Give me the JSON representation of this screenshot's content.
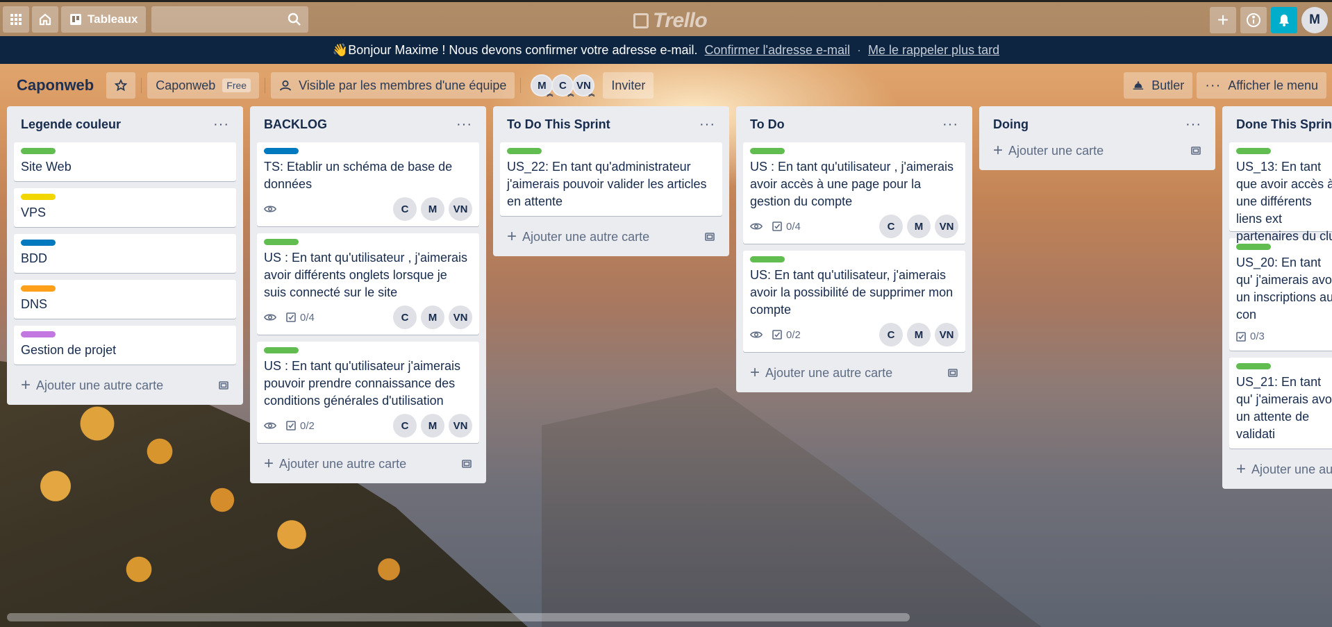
{
  "header": {
    "boards_label": "Tableaux",
    "logo_text": "Trello",
    "avatar_initial": "M"
  },
  "banner": {
    "message": "👋Bonjour Maxime ! Nous devons confirmer votre adresse e-mail.",
    "confirm_link": "Confirmer l'adresse e-mail",
    "separator": "·",
    "remind_link": "Me le rappeler plus tard"
  },
  "board": {
    "title": "Caponweb",
    "team_name": "Caponweb",
    "plan_badge": "Free",
    "visibility": "Visible par les membres d'une équipe",
    "members": [
      "M",
      "C",
      "VN"
    ],
    "invite_label": "Inviter",
    "butler_label": "Butler",
    "menu_label": "Afficher le menu"
  },
  "lists": [
    {
      "title": "Legende couleur",
      "add_label": "Ajouter une autre carte",
      "cards": [
        {
          "label_color": "#61bd4f",
          "text": "Site Web"
        },
        {
          "label_color": "#f2d600",
          "text": "VPS"
        },
        {
          "label_color": "#0079bf",
          "text": "BDD"
        },
        {
          "label_color": "#ff9f1a",
          "text": "DNS"
        },
        {
          "label_color": "#c377e0",
          "text": "Gestion de projet"
        }
      ]
    },
    {
      "title": "BACKLOG",
      "add_label": "Ajouter une autre carte",
      "cards": [
        {
          "label_color": "#0079bf",
          "text": "TS: Etablir un schéma de base de données",
          "checklist": "",
          "members": [
            "C",
            "M",
            "VN"
          ]
        },
        {
          "label_color": "#61bd4f",
          "text": "US : En tant qu'utilisateur , j'aimerais avoir différents onglets lorsque je suis connecté sur le site",
          "checklist": "0/4",
          "members": [
            "C",
            "M",
            "VN"
          ]
        },
        {
          "label_color": "#61bd4f",
          "text": "US : En tant qu'utilisateur j'aimerais pouvoir prendre connaissance des conditions générales d'utilisation",
          "checklist": "0/2",
          "members": [
            "C",
            "M",
            "VN"
          ]
        }
      ]
    },
    {
      "title": "To Do This Sprint",
      "add_label": "Ajouter une autre carte",
      "cards": [
        {
          "label_color": "#61bd4f",
          "text": "US_22: En tant qu'administrateur j'aimerais pouvoir valider les articles en attente"
        }
      ]
    },
    {
      "title": "To Do",
      "add_label": "Ajouter une autre carte",
      "cards": [
        {
          "label_color": "#61bd4f",
          "text": "US : En tant qu'utilisateur , j'aimerais avoir accès à une page pour la gestion du compte",
          "checklist": "0/4",
          "members": [
            "C",
            "M",
            "VN"
          ]
        },
        {
          "label_color": "#61bd4f",
          "text": "US: En tant qu'utilisateur, j'aimerais avoir la possibilité de supprimer mon compte",
          "checklist": "0/2",
          "members": [
            "C",
            "M",
            "VN"
          ]
        }
      ]
    },
    {
      "title": "Doing",
      "add_label": "Ajouter une carte"
    },
    {
      "title": "Done This Sprint",
      "add_label": "Ajouter une au",
      "cards": [
        {
          "label_color": "#61bd4f",
          "text": "US_13: En tant que avoir accès à une différents liens ext partenaires du clu"
        },
        {
          "label_color": "#61bd4f",
          "text": "US_20: En tant qu' j'aimerais avoir un inscriptions au con",
          "checklist": "0/3"
        },
        {
          "label_color": "#61bd4f",
          "text": "US_21: En tant qu' j'aimerais avoir un attente de validati"
        }
      ]
    }
  ],
  "colors": {
    "banner_bg": "#0d2541",
    "notif_bg": "#00aecc",
    "list_bg": "#ebecf0"
  }
}
